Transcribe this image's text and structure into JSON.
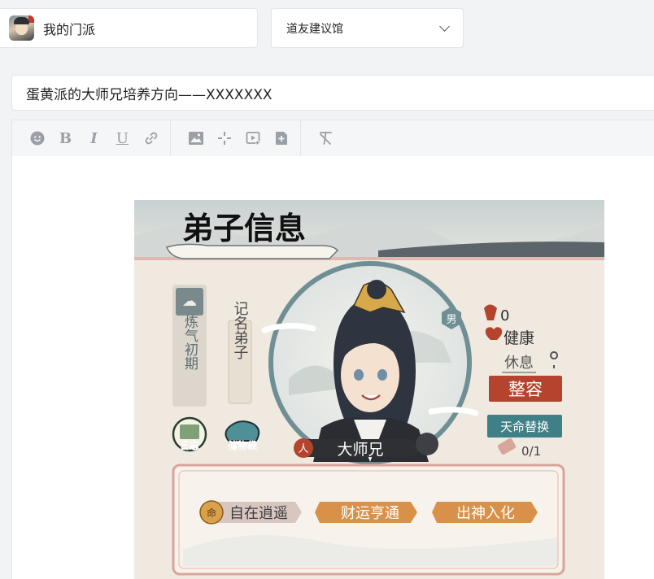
{
  "group": {
    "name": "我的门派",
    "avatar_icon": "game-avatar-icon"
  },
  "board": {
    "name": "道友建议馆"
  },
  "post": {
    "title": "蛋黄派的大师兄培养方向——XXXXXXX"
  },
  "toolbar": {
    "icons": [
      "emoji-icon",
      "bold-icon",
      "italic-icon",
      "underline-icon",
      "link-icon",
      "image-icon",
      "sparkle-icon",
      "video-icon",
      "file-add-icon",
      "clear-format-icon"
    ],
    "bold_glyph": "B",
    "italic_glyph": "I",
    "underline_glyph": "U"
  },
  "screenshot": {
    "banner_title": "弟子信息",
    "realm": "炼气初期",
    "rank": "记名弟子",
    "gender": "男",
    "fortune_count": "0",
    "health": "健康",
    "status": "休息",
    "btn_makeover": "整容",
    "btn_fate_replace": "天命替换",
    "scroll_count": "0/1",
    "log_label": "日志",
    "bag_label": "储物袋",
    "ren_glyph": "人",
    "ming_glyph": "命",
    "disciple_name": "大师兄",
    "traits": [
      "自在逍遥",
      "财运亨通",
      "出神入化"
    ],
    "colors": {
      "parchment": "#efe9e0",
      "red_button": "#b5442f",
      "teal_button": "#3f7f86",
      "trait_orange": "#d9914a",
      "frame_pink": "#d9a49c"
    }
  }
}
